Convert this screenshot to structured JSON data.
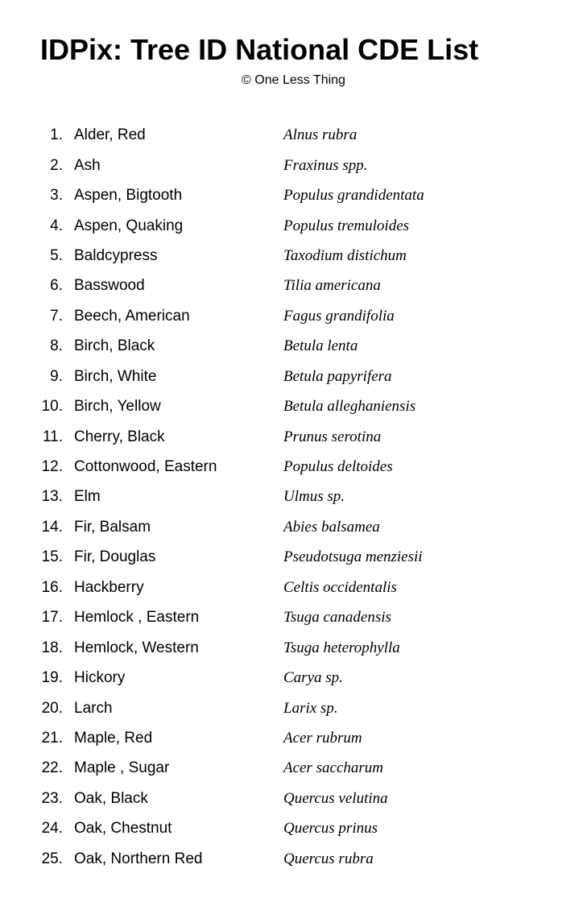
{
  "header": {
    "title": "IDPix: Tree ID National CDE List",
    "copyright": "© One Less Thing"
  },
  "trees": [
    {
      "number": "1.",
      "common": "Alder, Red",
      "scientific": "Alnus rubra"
    },
    {
      "number": "2.",
      "common": "Ash",
      "scientific": "Fraxinus spp."
    },
    {
      "number": "3.",
      "common": "Aspen, Bigtooth",
      "scientific": "Populus grandidentata"
    },
    {
      "number": "4.",
      "common": "Aspen, Quaking",
      "scientific": "Populus tremuloides"
    },
    {
      "number": "5.",
      "common": "Baldcypress",
      "scientific": "Taxodium distichum"
    },
    {
      "number": "6.",
      "common": "Basswood",
      "scientific": "Tilia americana"
    },
    {
      "number": "7.",
      "common": "Beech, American",
      "scientific": "Fagus grandifolia"
    },
    {
      "number": "8.",
      "common": "Birch, Black",
      "scientific": "Betula lenta"
    },
    {
      "number": "9.",
      "common": "Birch, White",
      "scientific": "Betula papyrifera"
    },
    {
      "number": "10.",
      "common": "Birch, Yellow",
      "scientific": "Betula alleghaniensis"
    },
    {
      "number": "11.",
      "common": "Cherry, Black",
      "scientific": "Prunus serotina"
    },
    {
      "number": "12.",
      "common": "Cottonwood, Eastern",
      "scientific": "Populus deltoides"
    },
    {
      "number": "13.",
      "common": "Elm",
      "scientific": "Ulmus sp."
    },
    {
      "number": "14.",
      "common": "Fir, Balsam",
      "scientific": "Abies balsamea"
    },
    {
      "number": "15.",
      "common": "Fir, Douglas",
      "scientific": "Pseudotsuga menziesii"
    },
    {
      "number": "16.",
      "common": "Hackberry",
      "scientific": " Celtis occidentalis"
    },
    {
      "number": "17.",
      "common": "Hemlock , Eastern",
      "scientific": "Tsuga canadensis"
    },
    {
      "number": "18.",
      "common": "Hemlock, Western",
      "scientific": "Tsuga heterophylla"
    },
    {
      "number": "19.",
      "common": "Hickory",
      "scientific": "Carya sp."
    },
    {
      "number": "20.",
      "common": "Larch",
      "scientific": "Larix sp."
    },
    {
      "number": "21.",
      "common": "Maple, Red",
      "scientific": "Acer rubrum"
    },
    {
      "number": "22.",
      "common": "Maple , Sugar",
      "scientific": "Acer saccharum"
    },
    {
      "number": "23.",
      "common": "Oak, Black",
      "scientific": "Quercus velutina"
    },
    {
      "number": "24.",
      "common": "Oak, Chestnut",
      "scientific": "Quercus prinus"
    },
    {
      "number": "25.",
      "common": "Oak, Northern Red",
      "scientific": "Quercus rubra"
    }
  ]
}
